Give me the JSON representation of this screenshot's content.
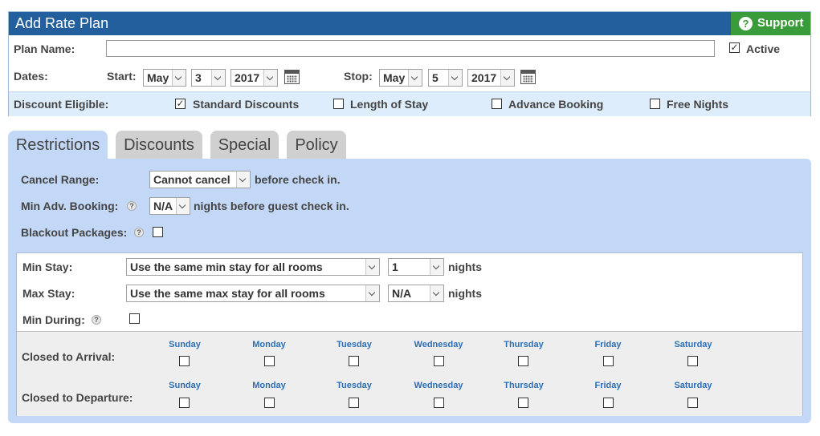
{
  "header": {
    "title": "Add Rate Plan",
    "support_label": "Support",
    "support_icon": "?"
  },
  "form": {
    "plan_name_label": "Plan Name:",
    "plan_name_value": "",
    "active_label": "Active",
    "active_checked": true,
    "dates_label": "Dates:",
    "start_label": "Start:",
    "start": {
      "month": "May",
      "day": "3",
      "year": "2017"
    },
    "stop_label": "Stop:",
    "stop": {
      "month": "May",
      "day": "5",
      "year": "2017"
    },
    "discount_label": "Discount Eligible:",
    "discounts": [
      {
        "label": "Standard Discounts",
        "checked": true
      },
      {
        "label": "Length of Stay",
        "checked": false
      },
      {
        "label": "Advance Booking",
        "checked": false
      },
      {
        "label": "Free Nights",
        "checked": false
      }
    ]
  },
  "tabs": [
    {
      "label": "Restrictions",
      "active": true
    },
    {
      "label": "Discounts",
      "active": false
    },
    {
      "label": "Special",
      "active": false
    },
    {
      "label": "Policy",
      "active": false
    }
  ],
  "restrictions": {
    "cancel_range_label": "Cancel Range:",
    "cancel_range_value": "Cannot cancel",
    "cancel_range_suffix": "before check in.",
    "min_adv_label": "Min Adv. Booking:",
    "min_adv_value": "N/A",
    "min_adv_suffix": "nights before guest check in.",
    "blackout_label": "Blackout Packages:",
    "help_glyph": "?",
    "min_stay_label": "Min Stay:",
    "min_stay_mode": "Use the same min stay for all rooms",
    "min_stay_value": "1",
    "max_stay_label": "Max Stay:",
    "max_stay_mode": "Use the same max stay for all rooms",
    "max_stay_value": "N/A",
    "nights_label": "nights",
    "min_during_label": "Min During:",
    "closed_arrival_label": "Closed to Arrival:",
    "closed_departure_label": "Closed to Departure:",
    "days": [
      "Sunday",
      "Monday",
      "Tuesday",
      "Wednesday",
      "Thursday",
      "Friday",
      "Saturday"
    ]
  },
  "colors": {
    "title_bar": "#245f9d",
    "support": "#3a9b3a",
    "panel": "#c2d8f6",
    "day_label": "#2d6fb6"
  }
}
